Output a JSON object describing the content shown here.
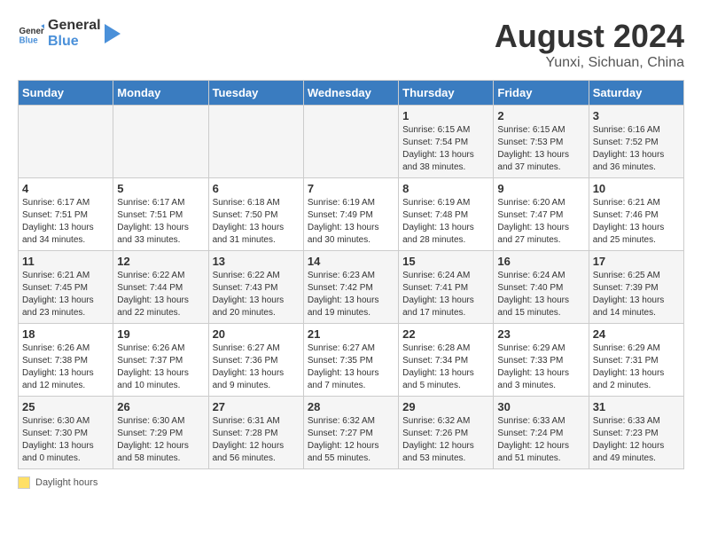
{
  "logo": {
    "text_general": "General",
    "text_blue": "Blue"
  },
  "title": "August 2024",
  "subtitle": "Yunxi, Sichuan, China",
  "days_of_week": [
    "Sunday",
    "Monday",
    "Tuesday",
    "Wednesday",
    "Thursday",
    "Friday",
    "Saturday"
  ],
  "weeks": [
    [
      {
        "day": "",
        "info": ""
      },
      {
        "day": "",
        "info": ""
      },
      {
        "day": "",
        "info": ""
      },
      {
        "day": "",
        "info": ""
      },
      {
        "day": "1",
        "info": "Sunrise: 6:15 AM\nSunset: 7:54 PM\nDaylight: 13 hours and 38 minutes."
      },
      {
        "day": "2",
        "info": "Sunrise: 6:15 AM\nSunset: 7:53 PM\nDaylight: 13 hours and 37 minutes."
      },
      {
        "day": "3",
        "info": "Sunrise: 6:16 AM\nSunset: 7:52 PM\nDaylight: 13 hours and 36 minutes."
      }
    ],
    [
      {
        "day": "4",
        "info": "Sunrise: 6:17 AM\nSunset: 7:51 PM\nDaylight: 13 hours and 34 minutes."
      },
      {
        "day": "5",
        "info": "Sunrise: 6:17 AM\nSunset: 7:51 PM\nDaylight: 13 hours and 33 minutes."
      },
      {
        "day": "6",
        "info": "Sunrise: 6:18 AM\nSunset: 7:50 PM\nDaylight: 13 hours and 31 minutes."
      },
      {
        "day": "7",
        "info": "Sunrise: 6:19 AM\nSunset: 7:49 PM\nDaylight: 13 hours and 30 minutes."
      },
      {
        "day": "8",
        "info": "Sunrise: 6:19 AM\nSunset: 7:48 PM\nDaylight: 13 hours and 28 minutes."
      },
      {
        "day": "9",
        "info": "Sunrise: 6:20 AM\nSunset: 7:47 PM\nDaylight: 13 hours and 27 minutes."
      },
      {
        "day": "10",
        "info": "Sunrise: 6:21 AM\nSunset: 7:46 PM\nDaylight: 13 hours and 25 minutes."
      }
    ],
    [
      {
        "day": "11",
        "info": "Sunrise: 6:21 AM\nSunset: 7:45 PM\nDaylight: 13 hours and 23 minutes."
      },
      {
        "day": "12",
        "info": "Sunrise: 6:22 AM\nSunset: 7:44 PM\nDaylight: 13 hours and 22 minutes."
      },
      {
        "day": "13",
        "info": "Sunrise: 6:22 AM\nSunset: 7:43 PM\nDaylight: 13 hours and 20 minutes."
      },
      {
        "day": "14",
        "info": "Sunrise: 6:23 AM\nSunset: 7:42 PM\nDaylight: 13 hours and 19 minutes."
      },
      {
        "day": "15",
        "info": "Sunrise: 6:24 AM\nSunset: 7:41 PM\nDaylight: 13 hours and 17 minutes."
      },
      {
        "day": "16",
        "info": "Sunrise: 6:24 AM\nSunset: 7:40 PM\nDaylight: 13 hours and 15 minutes."
      },
      {
        "day": "17",
        "info": "Sunrise: 6:25 AM\nSunset: 7:39 PM\nDaylight: 13 hours and 14 minutes."
      }
    ],
    [
      {
        "day": "18",
        "info": "Sunrise: 6:26 AM\nSunset: 7:38 PM\nDaylight: 13 hours and 12 minutes."
      },
      {
        "day": "19",
        "info": "Sunrise: 6:26 AM\nSunset: 7:37 PM\nDaylight: 13 hours and 10 minutes."
      },
      {
        "day": "20",
        "info": "Sunrise: 6:27 AM\nSunset: 7:36 PM\nDaylight: 13 hours and 9 minutes."
      },
      {
        "day": "21",
        "info": "Sunrise: 6:27 AM\nSunset: 7:35 PM\nDaylight: 13 hours and 7 minutes."
      },
      {
        "day": "22",
        "info": "Sunrise: 6:28 AM\nSunset: 7:34 PM\nDaylight: 13 hours and 5 minutes."
      },
      {
        "day": "23",
        "info": "Sunrise: 6:29 AM\nSunset: 7:33 PM\nDaylight: 13 hours and 3 minutes."
      },
      {
        "day": "24",
        "info": "Sunrise: 6:29 AM\nSunset: 7:31 PM\nDaylight: 13 hours and 2 minutes."
      }
    ],
    [
      {
        "day": "25",
        "info": "Sunrise: 6:30 AM\nSunset: 7:30 PM\nDaylight: 13 hours and 0 minutes."
      },
      {
        "day": "26",
        "info": "Sunrise: 6:30 AM\nSunset: 7:29 PM\nDaylight: 12 hours and 58 minutes."
      },
      {
        "day": "27",
        "info": "Sunrise: 6:31 AM\nSunset: 7:28 PM\nDaylight: 12 hours and 56 minutes."
      },
      {
        "day": "28",
        "info": "Sunrise: 6:32 AM\nSunset: 7:27 PM\nDaylight: 12 hours and 55 minutes."
      },
      {
        "day": "29",
        "info": "Sunrise: 6:32 AM\nSunset: 7:26 PM\nDaylight: 12 hours and 53 minutes."
      },
      {
        "day": "30",
        "info": "Sunrise: 6:33 AM\nSunset: 7:24 PM\nDaylight: 12 hours and 51 minutes."
      },
      {
        "day": "31",
        "info": "Sunrise: 6:33 AM\nSunset: 7:23 PM\nDaylight: 12 hours and 49 minutes."
      }
    ]
  ],
  "footer": {
    "daylight_label": "Daylight hours"
  }
}
